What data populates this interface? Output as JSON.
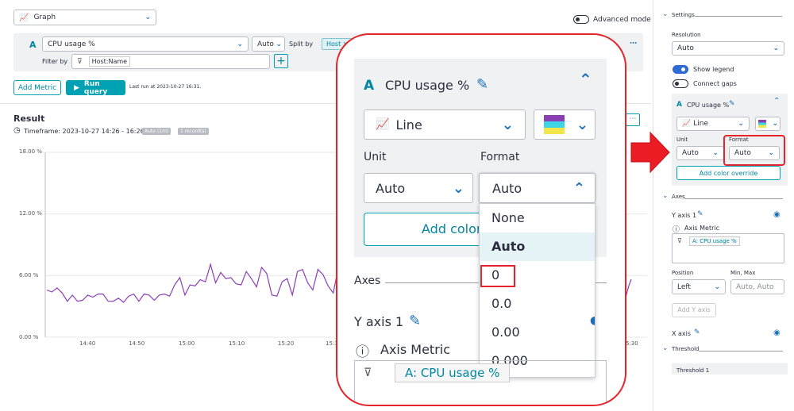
{
  "header": {
    "viz_type": "Graph",
    "advanced_mode": "Advanced mode"
  },
  "query": {
    "letter": "A",
    "metric": "CPU usage %",
    "agg": "Auto",
    "split_by_label": "Split by",
    "split_value": "Host",
    "filter_label": "Filter by",
    "filter_value": "Host:Name"
  },
  "actions": {
    "add_metric": "Add Metric",
    "run_query": "Run query",
    "last_run": "Last run at 2023-10-27 16:31."
  },
  "result": {
    "title": "Result",
    "timeframe": "Timeframe: 2023-10-27 14:26 - 16:26",
    "badge_auto": "Auto (1m)",
    "badge_records": "1 record(s)"
  },
  "chart_data": {
    "type": "line",
    "yticks": [
      "18.00 %",
      "12.00 %",
      "6.00 %",
      "0.00 %"
    ],
    "xticks": [
      "14:40",
      "14:50",
      "15:00",
      "15:10",
      "15:20",
      "15:3",
      "5:30"
    ],
    "ylim": [
      0,
      18
    ],
    "series": [
      {
        "values": [
          4.6,
          4.4,
          4.8,
          4.3,
          3.5,
          4.1,
          3.5,
          3.6,
          4.1,
          3.9,
          4.2,
          4.2,
          3.5,
          3.5,
          3.8,
          3.4,
          4,
          4.2,
          3.5,
          4.2,
          4.1,
          3.6,
          4.1,
          4.2,
          4,
          5.1,
          5.8,
          4.1,
          5.1,
          5,
          5.6,
          5.4,
          7.1,
          5.3,
          6.3,
          5.7,
          5.8,
          5.2,
          5.1,
          6.4,
          5.7,
          4.9,
          6.8,
          6.2,
          4.1,
          4,
          5.4,
          5.7,
          4.1,
          6.4,
          6.6,
          5.3,
          4.6,
          6.6,
          6.1,
          5,
          4.3,
          6.8,
          4.1,
          4.1
        ]
      }
    ]
  },
  "zoom": {
    "letter": "A",
    "metric": "CPU usage %",
    "chart_type": "Line",
    "unit_label": "Unit",
    "format_label": "Format",
    "unit_value": "Auto",
    "format_value": "Auto",
    "add_color": "Add color",
    "options": [
      "None",
      "Auto",
      "0",
      "0.0",
      "0.00",
      "0.000"
    ],
    "axes": "Axes",
    "y_axis": "Y axis 1",
    "axis_metric": "Axis Metric",
    "metric_chip": "A: CPU usage %"
  },
  "settings": {
    "title": "Settings",
    "resolution_label": "Resolution",
    "resolution_value": "Auto",
    "show_legend": "Show legend",
    "connect_gaps": "Connect gaps",
    "metric_letter": "A",
    "metric": "CPU usage %",
    "chart_type": "Line",
    "unit_label": "Unit",
    "format_label": "Format",
    "unit_value": "Auto",
    "format_value": "Auto",
    "add_color_override": "Add color override",
    "axes": "Axes",
    "y_axis": "Y axis 1",
    "axis_metric": "Axis Metric",
    "metric_chip": "A: CPU usage %",
    "position_label": "Position",
    "minmax_label": "Min, Max",
    "position_value": "Left",
    "minmax_placeholder": "Auto, Auto",
    "add_y_axis": "Add Y axis",
    "x_axis": "X axis",
    "threshold": "Threshold",
    "threshold_item": "Threshold 1"
  },
  "colors": {
    "accent": "#00a1b2",
    "highlight": "#e4262c",
    "series": "#8b3fb5"
  }
}
